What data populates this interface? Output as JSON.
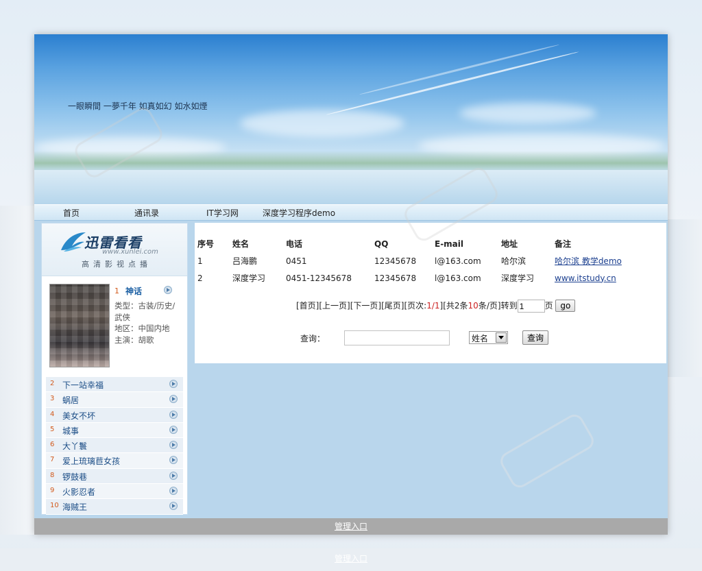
{
  "banner": {
    "slogan": "一眼瞬間 一夢千年 如真如幻 如水如煙"
  },
  "nav": [
    {
      "label": "首页"
    },
    {
      "label": "通讯录"
    },
    {
      "label": "IT学习网"
    },
    {
      "label": "深度学习程序demo"
    }
  ],
  "sidebar": {
    "logo": {
      "brand": "迅雷看看",
      "url": "www.xunlei.com",
      "tagline": "高清影视点播"
    },
    "featured": {
      "rank": "1",
      "title": "神话",
      "genre": "类型：古装/历史/武侠",
      "region": "地区：中国内地",
      "star": "主演：胡歌"
    },
    "list": [
      {
        "rank": "2",
        "title": "下一站幸福"
      },
      {
        "rank": "3",
        "title": "蜗居"
      },
      {
        "rank": "4",
        "title": "美女不坏"
      },
      {
        "rank": "5",
        "title": "城事"
      },
      {
        "rank": "6",
        "title": "大丫鬟"
      },
      {
        "rank": "7",
        "title": "爱上琉璃苣女孩"
      },
      {
        "rank": "8",
        "title": "锣鼓巷"
      },
      {
        "rank": "9",
        "title": "火影忍者"
      },
      {
        "rank": "10",
        "title": "海贼王"
      }
    ]
  },
  "table": {
    "headers": [
      "序号",
      "姓名",
      "电话",
      "QQ",
      "E-mail",
      "地址",
      "备注"
    ],
    "rows": [
      [
        "1",
        "吕海鹏",
        "0451",
        "12345678",
        "l@163.com",
        "哈尔滨",
        "哈尔滨 教学demo"
      ],
      [
        "2",
        "深度学习",
        "0451-12345678",
        "12345678",
        "l@163.com",
        "深度学习",
        "www.itstudy.cn"
      ]
    ]
  },
  "pager": {
    "first": "[首页]",
    "prev": "[上一页]",
    "next": "[下一页]",
    "last": "[尾页]",
    "page_prefix": "[页次:",
    "page_value": "1/1",
    "total_prefix": "][共2条",
    "per_page": "10",
    "per_page_suffix": "条/页]",
    "goto_label": "转到",
    "goto_value": "1",
    "page_unit": "页",
    "go_label": "go"
  },
  "search": {
    "label": "查询：",
    "value": "",
    "field_selected": "姓名",
    "button_label": "查询"
  },
  "footer": {
    "admin_link": "管理入口"
  }
}
